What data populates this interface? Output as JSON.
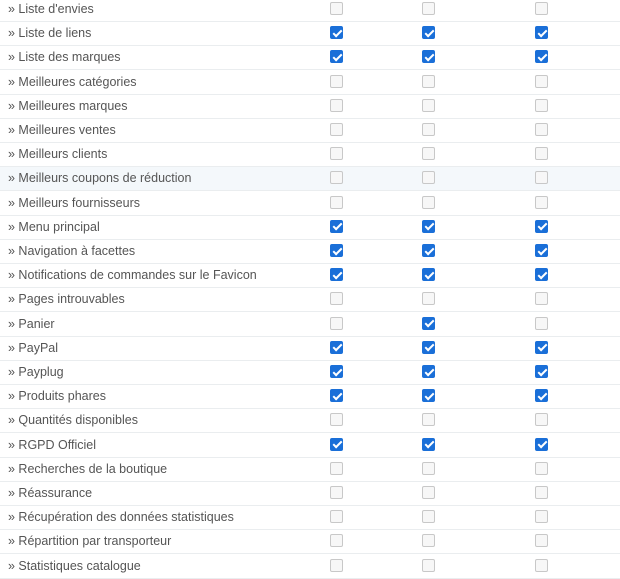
{
  "rows": [
    {
      "label": "» Liste d'envies",
      "checks": [
        false,
        false,
        false
      ]
    },
    {
      "label": "» Liste de liens",
      "checks": [
        true,
        true,
        true
      ]
    },
    {
      "label": "» Liste des marques",
      "checks": [
        true,
        true,
        true
      ]
    },
    {
      "label": "» Meilleures catégories",
      "checks": [
        false,
        false,
        false
      ]
    },
    {
      "label": "» Meilleures marques",
      "checks": [
        false,
        false,
        false
      ]
    },
    {
      "label": "» Meilleures ventes",
      "checks": [
        false,
        false,
        false
      ]
    },
    {
      "label": "» Meilleurs clients",
      "checks": [
        false,
        false,
        false
      ]
    },
    {
      "label": "» Meilleurs coupons de réduction",
      "checks": [
        false,
        false,
        false
      ],
      "highlight": true
    },
    {
      "label": "» Meilleurs fournisseurs",
      "checks": [
        false,
        false,
        false
      ]
    },
    {
      "label": "» Menu principal",
      "checks": [
        true,
        true,
        true
      ]
    },
    {
      "label": "» Navigation à facettes",
      "checks": [
        true,
        true,
        true
      ]
    },
    {
      "label": "» Notifications de commandes sur le Favicon",
      "checks": [
        true,
        true,
        true
      ]
    },
    {
      "label": "» Pages introuvables",
      "checks": [
        false,
        false,
        false
      ]
    },
    {
      "label": "» Panier",
      "checks": [
        false,
        true,
        false
      ]
    },
    {
      "label": "» PayPal",
      "checks": [
        true,
        true,
        true
      ]
    },
    {
      "label": "» Payplug",
      "checks": [
        true,
        true,
        true
      ]
    },
    {
      "label": "» Produits phares",
      "checks": [
        true,
        true,
        true
      ]
    },
    {
      "label": "» Quantités disponibles",
      "checks": [
        false,
        false,
        false
      ]
    },
    {
      "label": "» RGPD Officiel",
      "checks": [
        true,
        true,
        true
      ]
    },
    {
      "label": "» Recherches de la boutique",
      "checks": [
        false,
        false,
        false
      ]
    },
    {
      "label": "» Réassurance",
      "checks": [
        false,
        false,
        false
      ]
    },
    {
      "label": "» Récupération des données statistiques",
      "checks": [
        false,
        false,
        false
      ]
    },
    {
      "label": "» Répartition par transporteur",
      "checks": [
        false,
        false,
        false
      ]
    },
    {
      "label": "» Statistiques catalogue",
      "checks": [
        false,
        false,
        false
      ]
    }
  ]
}
